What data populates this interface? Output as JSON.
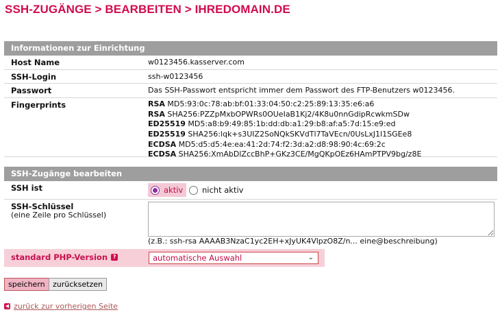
{
  "breadcrumb": {
    "title": "SSH-ZUGÄNGE > BEARBEITEN > IHREDOMAIN.DE"
  },
  "info_section": {
    "header": "Informationen zur Einrichtung",
    "host_label": "Host Name",
    "host_value": "w0123456.kasserver.com",
    "login_label": "SSH-Login",
    "login_value": "ssh-w0123456",
    "password_label": "Passwort",
    "password_value": "Das SSH-Passwort entspricht immer dem Passwort des FTP-Benutzers w0123456.",
    "fingerprints_label": "Fingerprints",
    "fingerprints": [
      {
        "type": "RSA",
        "value": "MD5:93:0c:78:ab:bf:01:33:04:50:c2:25:89:13:35:e6:a6"
      },
      {
        "type": "RSA",
        "value": "SHA256:PZZpMxbOPWRs0OUeIaB1Kj2/4K8u0nnGdipRcwkmSDw"
      },
      {
        "type": "ED25519",
        "value": "MD5:a8:b9:49:85:1b:dd:db:a1:29:b8:af:a5:7d:15:e9:ed"
      },
      {
        "type": "ED25519",
        "value": "SHA256:lqk+s3UIZ2SoNQkSKVdTl7TaVEcn/0UsLxJ1l1SGEe8"
      },
      {
        "type": "ECDSA",
        "value": "MD5:d5:d5:4e:ea:41:2d:74:f2:3d:a2:d8:98:90:4c:69:2c"
      },
      {
        "type": "ECDSA",
        "value": "SHA256:XmAbDlZccBhP+GKz3CE/MgQKpOEz6HAmPTPV9bg/z8E"
      }
    ]
  },
  "edit_section": {
    "header": "SSH-Zugänge bearbeiten",
    "ssh_status_label": "SSH ist",
    "radio_active": "aktiv",
    "radio_inactive": "nicht aktiv",
    "keys_label": "SSH-Schlüssel",
    "keys_sublabel": "(eine Zeile pro Schlüssel)",
    "keys_value": "",
    "keys_hint": "(z.B.: ssh-rsa AAAAB3NzaC1yc2EH+xJyUK4VlpzO8Z/n... eine@beschreibung)",
    "php_label": "standard PHP-Version",
    "php_selected": "automatische Auswahl"
  },
  "actions": {
    "save_label": "speichern",
    "reset_label": "zurücksetzen",
    "back_label": "zurück zur vorherigen Seite"
  },
  "colors": {
    "accent": "#d10a4f",
    "header_bg": "#9e9e9e",
    "highlight_bg": "#f6cfd9"
  }
}
